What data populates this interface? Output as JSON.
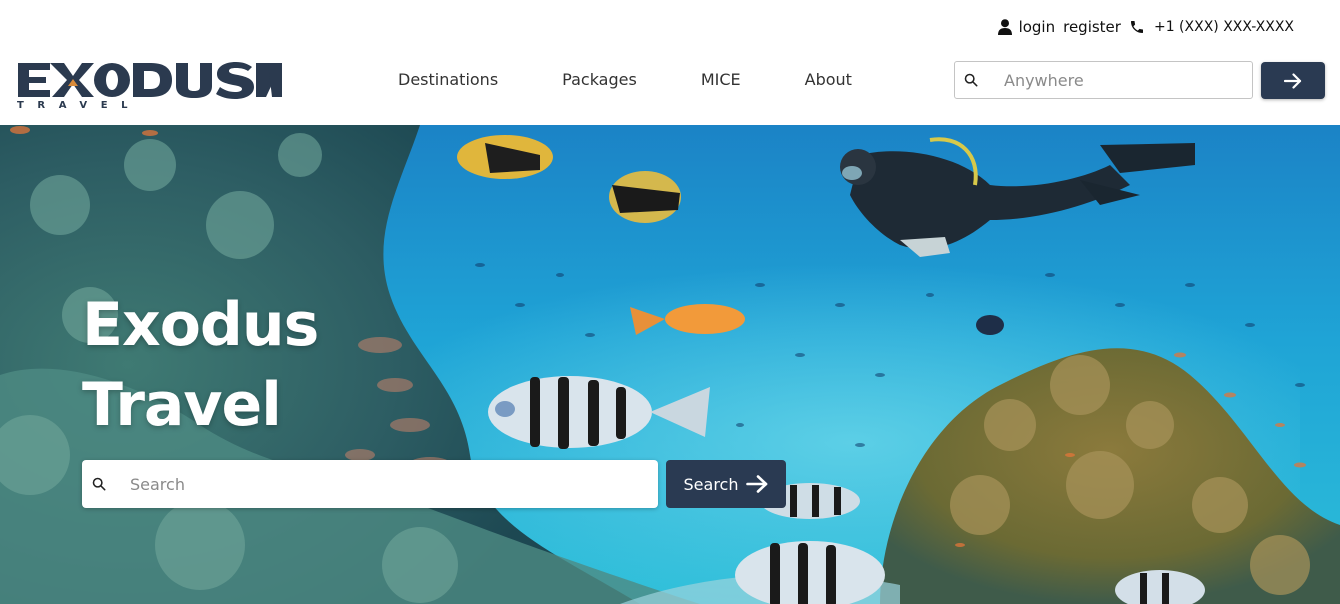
{
  "topbar": {
    "login": "login",
    "register": "register",
    "phone": "+1 (XXX) XXX-XXXX",
    "icons": {
      "user": "user-icon",
      "phone": "phone-icon"
    }
  },
  "brand": {
    "name": "EXODUS",
    "tagline": "TRAVEL",
    "primary_color": "#2b3a4f",
    "accent_color": "#d98b3a"
  },
  "nav": {
    "items": [
      {
        "label": "Destinations"
      },
      {
        "label": "Packages"
      },
      {
        "label": "MICE"
      },
      {
        "label": "About"
      }
    ]
  },
  "header_search": {
    "placeholder": "Anywhere",
    "icon": "search-icon",
    "submit_icon": "arrow-right-icon"
  },
  "hero": {
    "title_line1": "Exodus",
    "title_line2": "Travel",
    "search_placeholder": "Search",
    "search_button": "Search",
    "background": "underwater coral reef photo"
  },
  "colors": {
    "button_bg": "#2a3a52",
    "text_white": "#ffffff"
  }
}
